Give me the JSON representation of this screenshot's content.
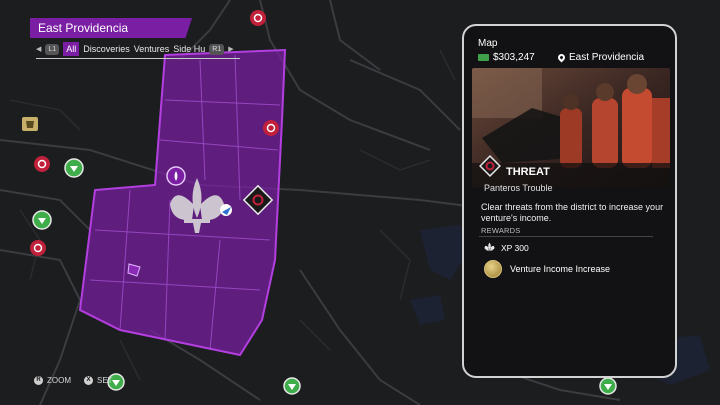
{
  "district": "East Providencia",
  "filters": {
    "left_badge": "L1",
    "right_badge": "R1",
    "items": [
      "All",
      "Discoveries",
      "Ventures",
      "Side Hu"
    ],
    "selected": "All"
  },
  "hints": [
    {
      "button": "R",
      "label": "ZOOM"
    },
    {
      "button": "X",
      "label": "SET"
    }
  ],
  "panel": {
    "title": "Map",
    "money": "$303,247",
    "location": "East Providencia",
    "activity_type": "THREAT",
    "activity_name": "Panteros Trouble",
    "description": "Clear threats from the district to increase your venture's income.",
    "rewards_heading": "REWARDS",
    "rewards": [
      {
        "icon": "saints-fleur-icon",
        "label": "XP 300"
      },
      {
        "icon": "venture-coin-icon",
        "label": "Venture Income Increase"
      }
    ]
  },
  "colors": {
    "district_fill": "#7a1fa3",
    "map_background": "#1b1c1e",
    "water": "#1d2233",
    "threat_red": "#c0203a",
    "activity_green": "#3fae4a"
  }
}
